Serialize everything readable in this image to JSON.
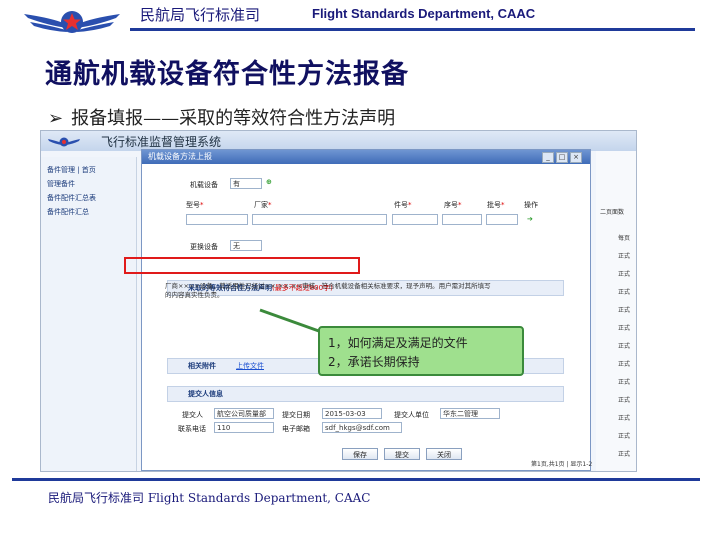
{
  "header": {
    "cn_title": "民航局飞行标准司",
    "en_title": "Flight Standards Department, CAAC"
  },
  "slide": {
    "title": "通航机载设备符合性方法报备",
    "bullet": "报备填报——采取的等效符合性方法声明"
  },
  "app": {
    "brand": "飞行标准监督管理系统",
    "sidebar": [
      "备件管理 | 首页",
      "管理备件",
      "备件配件汇总表",
      "备件配件汇总"
    ],
    "right_col": [
      "二页面数",
      "每页",
      "正式",
      "正式",
      "正式",
      "正式",
      "正式",
      "正式",
      "正式",
      "正式",
      "正式",
      "正式",
      "正式",
      "正式"
    ],
    "dialog": {
      "title": "机载设备方法上报",
      "win_buttons": [
        "_",
        "□",
        "×"
      ],
      "field_device_label": "机载设备",
      "field_device_value": "有",
      "cols": [
        "型号",
        "厂家",
        "件号",
        "序号",
        "批号",
        "操作"
      ],
      "field_replace_label": "更换设备",
      "field_replace_value": "无",
      "section_method": "采取的等效符合性方法声明",
      "section_method_hint": "(最多不超过800字)",
      "statement": "厂商××××设备，其适用性已经过××-××-××审核，符合机载设备相关标准要求，现予声明。用户需对其所填写的内容真实性负责。",
      "section_related": "相关附件",
      "related_link": "上传文件",
      "section_submitter": "提交人信息",
      "submitter_label": "提交人",
      "submitter_value": "航空公司质量部",
      "date_label": "提交日期",
      "date_value": "2015-03-03",
      "unit_label": "提交人单位",
      "unit_value": "华东二管理",
      "phone_label": "联系电话",
      "phone_value": "110",
      "email_label": "电子邮箱",
      "email_value": "sdf_hkgs@sdf.com",
      "buttons": [
        "保存",
        "提交",
        "关闭"
      ]
    },
    "status": "第1页,共1页 | 显示1-2"
  },
  "callout": {
    "line1": "1，如何满足及满足的文件",
    "line2": "2，承诺长期保持"
  },
  "footer": {
    "text": "民航局飞行标准司 Flight Standards Department, CAAC"
  }
}
